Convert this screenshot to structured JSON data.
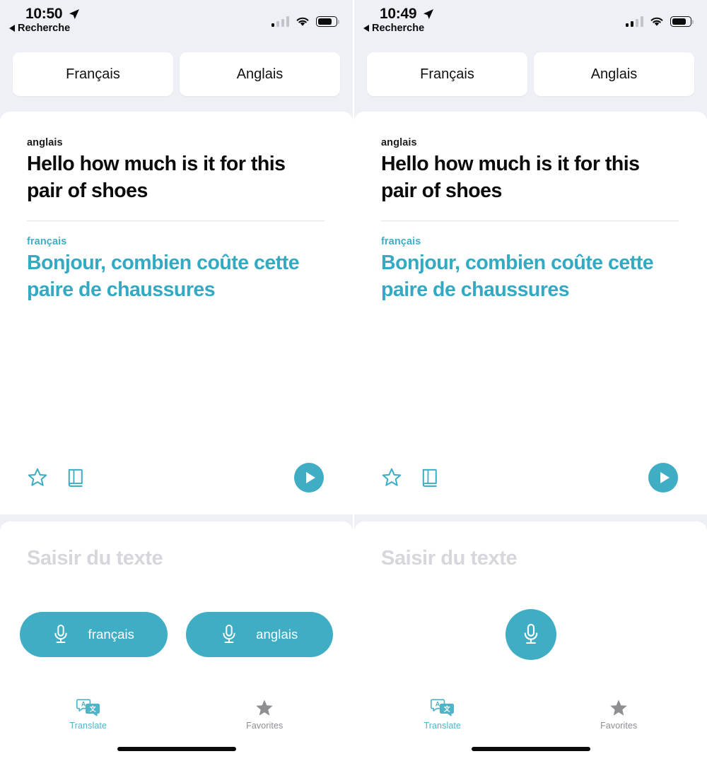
{
  "theme": {
    "accent": "#3fadc4",
    "accent_text": "#33aac2",
    "page_bg": "#eff0f5",
    "card_bg": "#ffffff",
    "placeholder_gray": "#d6d7dc",
    "inactive_gray": "#8e8e93"
  },
  "panels": [
    {
      "id": "left",
      "status_bar": {
        "time": "10:50",
        "location_icon": "location-arrow-icon",
        "back_label": "Recherche",
        "back_icon": "back-triangle-icon",
        "signal_icon": "cellular-signal-icon",
        "signal_bars_filled": 1,
        "signal_bars_total": 4,
        "wifi_icon": "wifi-icon",
        "battery_icon": "battery-icon",
        "battery_level_percent": 72
      },
      "language_bar": {
        "source_button": "Français",
        "target_button": "Anglais"
      },
      "translation": {
        "source_language": "anglais",
        "source_text": "Hello how much is it for this pair of shoes",
        "target_language": "français",
        "target_text": "Bonjour, combien coûte cette paire de chaussures",
        "actions": {
          "favorite_icon": "star-outline-icon",
          "dictionary_icon": "book-icon",
          "play_icon": "play-circle-icon"
        }
      },
      "input_card": {
        "placeholder": "Saisir du texte",
        "mic_mode": "two-pills",
        "mic_buttons": [
          {
            "icon": "microphone-icon",
            "label": "français"
          },
          {
            "icon": "microphone-icon",
            "label": "anglais"
          }
        ]
      },
      "tab_bar": {
        "tabs": [
          {
            "icon": "translate-bubbles-icon",
            "label": "Translate",
            "active": true
          },
          {
            "icon": "star-filled-icon",
            "label": "Favorites",
            "active": false
          }
        ]
      }
    },
    {
      "id": "right",
      "status_bar": {
        "time": "10:49",
        "location_icon": "location-arrow-icon",
        "back_label": "Recherche",
        "back_icon": "back-triangle-icon",
        "signal_icon": "cellular-signal-icon",
        "signal_bars_filled": 2,
        "signal_bars_total": 4,
        "wifi_icon": "wifi-icon",
        "battery_icon": "battery-icon",
        "battery_level_percent": 72
      },
      "language_bar": {
        "source_button": "Français",
        "target_button": "Anglais"
      },
      "translation": {
        "source_language": "anglais",
        "source_text": "Hello how much is it for this pair of shoes",
        "target_language": "français",
        "target_text": "Bonjour, combien coûte cette paire de chaussures",
        "actions": {
          "favorite_icon": "star-outline-icon",
          "dictionary_icon": "book-icon",
          "play_icon": "play-circle-icon"
        }
      },
      "input_card": {
        "placeholder": "Saisir du texte",
        "mic_mode": "single-circle",
        "mic_button": {
          "icon": "microphone-icon",
          "label": ""
        }
      },
      "tab_bar": {
        "tabs": [
          {
            "icon": "translate-bubbles-icon",
            "label": "Translate",
            "active": true
          },
          {
            "icon": "star-filled-icon",
            "label": "Favorites",
            "active": false
          }
        ]
      }
    }
  ]
}
